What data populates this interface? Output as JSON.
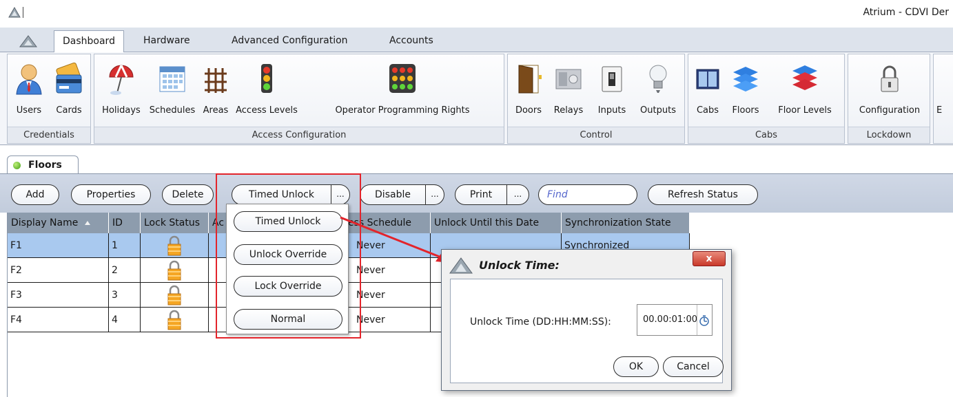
{
  "window": {
    "title": "Atrium - CDVI Der"
  },
  "tabs": [
    "Dashboard",
    "Hardware",
    "Advanced Configuration",
    "Accounts"
  ],
  "ribbon": {
    "groups": [
      {
        "label": "Credentials",
        "buttons": [
          "Users",
          "Cards"
        ]
      },
      {
        "label": "Access Configuration",
        "buttons": [
          "Holidays",
          "Schedules",
          "Areas",
          "Access Levels",
          "Operator Programming Rights"
        ]
      },
      {
        "label": "Control",
        "buttons": [
          "Doors",
          "Relays",
          "Inputs",
          "Outputs"
        ]
      },
      {
        "label": "Cabs",
        "buttons": [
          "Cabs",
          "Floors",
          "Floor Levels"
        ]
      },
      {
        "label": "Lockdown",
        "buttons": [
          "Configuration"
        ]
      }
    ],
    "partial_text": "E"
  },
  "panel_tab": {
    "label": "Floors"
  },
  "toolbar": {
    "add": "Add",
    "properties": "Properties",
    "delete": "Delete",
    "timed_unlock": "Timed Unlock",
    "disable": "Disable",
    "print": "Print",
    "more": "...",
    "find_placeholder": "Find",
    "refresh": "Refresh Status"
  },
  "grid": {
    "columns": [
      "Display Name",
      "ID",
      "Lock Status",
      "Ac",
      "ess Schedule",
      "Unlock Until this Date",
      "Synchronization State"
    ],
    "rows": [
      {
        "name": "F1",
        "id": "1",
        "schedule": "Never",
        "sync": "Synchronized"
      },
      {
        "name": "F2",
        "id": "2",
        "schedule": "Never",
        "sync": ""
      },
      {
        "name": "F3",
        "id": "3",
        "schedule": "Never",
        "sync": ""
      },
      {
        "name": "F4",
        "id": "4",
        "schedule": "Never",
        "sync": ""
      }
    ]
  },
  "dropdown": {
    "items": [
      "Timed Unlock",
      "Unlock Override",
      "Lock Override",
      "Normal"
    ]
  },
  "dialog": {
    "title": "Unlock Time:",
    "close": "x",
    "label": "Unlock Time (DD:HH:MM:SS):",
    "value": "00.00:01:00",
    "ok": "OK",
    "cancel": "Cancel"
  },
  "colors": {
    "highlight_box": "#e3242b",
    "selected_row": "#a9c9ef",
    "header": "#8d9cad",
    "toolbar": "#c8d1df",
    "find_text": "#5566cc"
  },
  "icons": [
    "app-logo-icon",
    "users-icon",
    "cards-icon",
    "holidays-icon",
    "schedules-icon",
    "areas-icon",
    "access-levels-icon",
    "operator-rights-icon",
    "doors-icon",
    "relays-icon",
    "inputs-icon",
    "outputs-icon",
    "cabs-icon",
    "floors-icon",
    "floor-levels-icon",
    "lockdown-configuration-icon",
    "padlock-icon",
    "sort-asc-icon",
    "status-dot-icon",
    "stopwatch-icon",
    "arrow-icon"
  ]
}
